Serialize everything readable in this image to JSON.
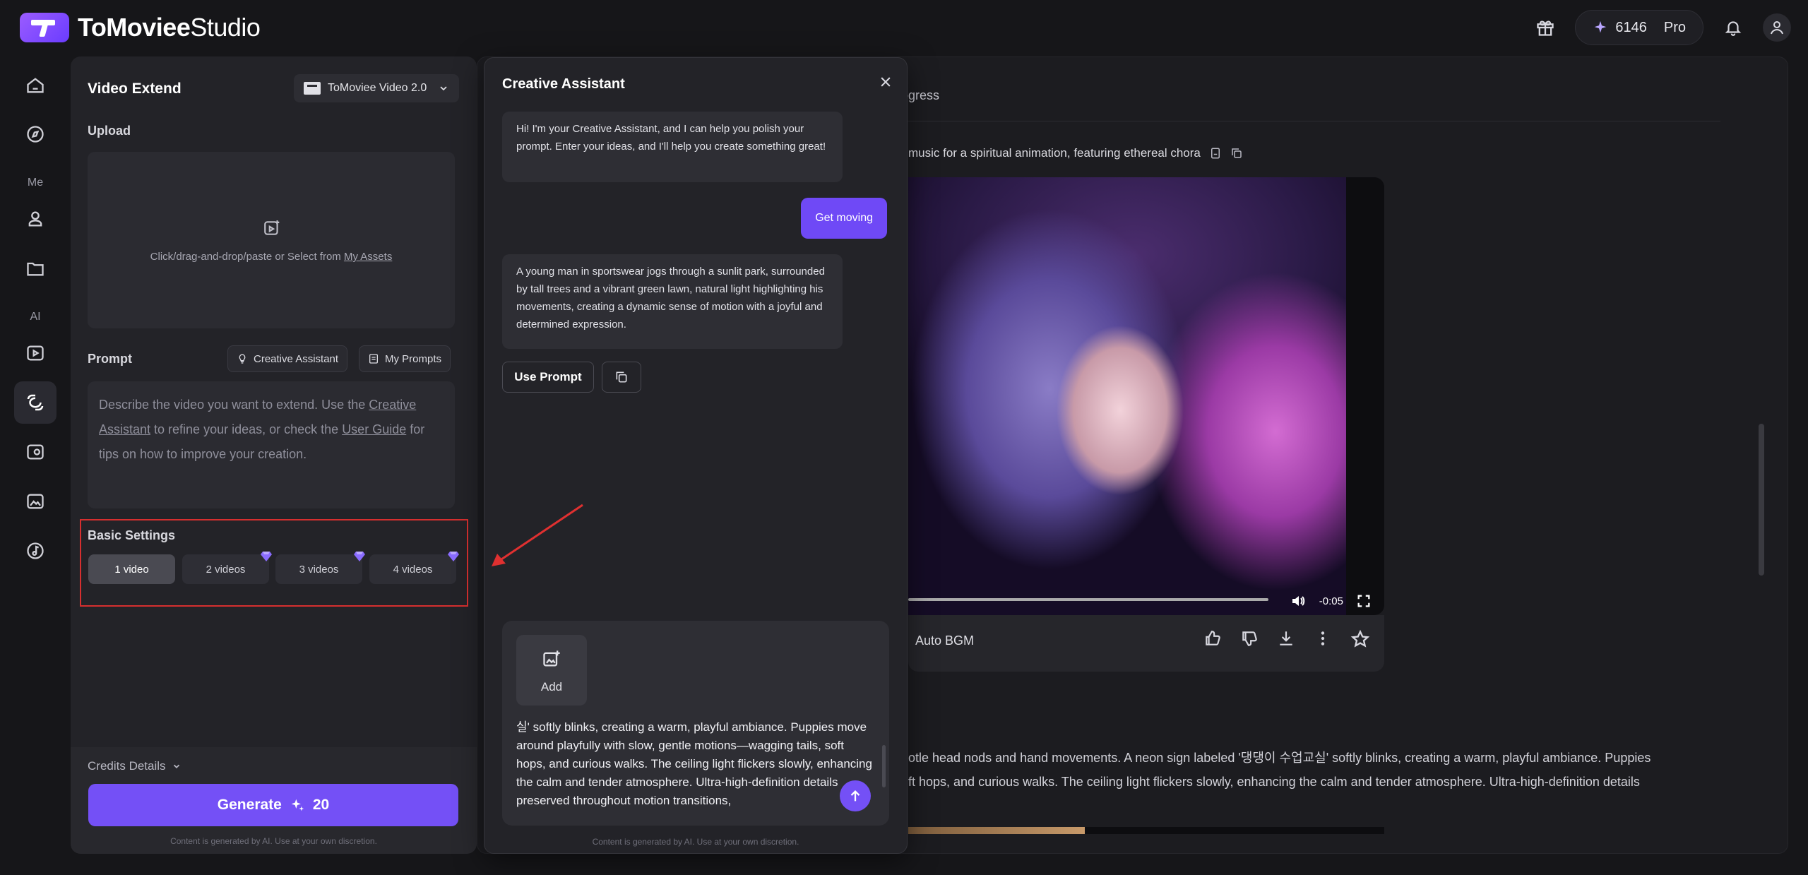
{
  "app": {
    "brand": "ToMoviee",
    "brand_suffix": "Studio",
    "credits": "6146",
    "plan": "Pro"
  },
  "rail": {
    "section_me": "Me",
    "section_ai": "AI"
  },
  "panel": {
    "title": "Video Extend",
    "model": "ToMoviee Video 2.0",
    "upload_label": "Upload",
    "upload_hint": "Click/drag-and-drop/paste or Select from ",
    "upload_link": "My Assets",
    "prompt_label": "Prompt",
    "creative_assistant_btn": "Creative Assistant",
    "my_prompts_btn": "My Prompts",
    "prompt_placeholder_1": "Describe the video you want to extend. Use the ",
    "prompt_link_1": "Creative Assistant",
    "prompt_placeholder_2": " to refine your ideas, or check the ",
    "prompt_link_2": "User Guide",
    "prompt_placeholder_3": " for tips on how to improve your creation.",
    "basic_settings": "Basic Settings",
    "video_options": [
      "1 video",
      "2 videos",
      "3 videos",
      "4 videos"
    ],
    "credits_details": "Credits Details",
    "generate_label": "Generate",
    "generate_cost": "20",
    "disclaimer": "Content is generated by AI. Use at your own discretion."
  },
  "main": {
    "tab_progress": "ogress",
    "prompt_preview": "music for a spiritual animation, featuring ethereal chora",
    "video_time": "-0:05",
    "bgm": "Auto BGM",
    "desc_line_1": "otle head nods and hand movements. A neon sign labeled '댕댕이 수업교실' softly blinks, creating a warm, playful ambiance. Puppies",
    "desc_line_2": "ft hops, and curious walks. The ceiling light flickers slowly, enhancing the calm and tender atmosphere. Ultra-high-definition details"
  },
  "assistant": {
    "title": "Creative Assistant",
    "greeting": "Hi! I'm your Creative Assistant, and I can help you polish your prompt. Enter your ideas, and I'll help you create something great!",
    "user_msg": "Get moving",
    "reply": "A young man in sportswear jogs through a sunlit park, surrounded by tall trees and a vibrant green lawn, natural light highlighting his movements, creating a dynamic sense of motion with a joyful and determined expression.",
    "use_prompt": "Use Prompt",
    "add_label": "Add",
    "compose_text": "실' softly blinks, creating a warm, playful ambiance. Puppies move around playfully with slow, gentle motions—wagging tails, soft hops, and curious walks. The ceiling light flickers slowly, enhancing the calm and tender atmosphere. Ultra-high-definition details preserved throughout motion transitions,",
    "disclaimer": "Content is generated by AI. Use at your own discretion."
  },
  "colors": {
    "accent": "#7450f6",
    "highlight_box": "#d62f2f"
  }
}
